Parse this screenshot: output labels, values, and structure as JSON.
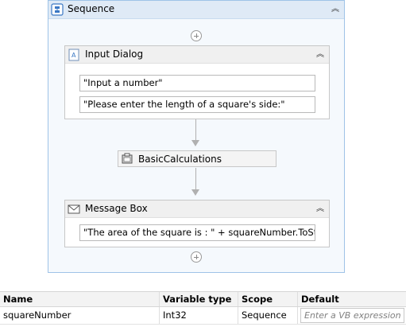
{
  "sequence": {
    "title": "Sequence",
    "icon": "sequence-icon",
    "collapse_glyph": "︽"
  },
  "input_dialog": {
    "title": "Input Dialog",
    "icon": "input-dialog-icon",
    "collapse_glyph": "︽",
    "title_field": "\"Input a number\"",
    "label_field": "\"Please enter the length of a square's side:\""
  },
  "basic_calculations": {
    "title": "BasicCalculations",
    "icon": "workflow-icon"
  },
  "message_box": {
    "title": "Message Box",
    "icon": "envelope-icon",
    "collapse_glyph": "︽",
    "text_field": "\"The area of the square is : \" + squareNumber.ToString"
  },
  "variables": {
    "headers": {
      "name": "Name",
      "type": "Variable type",
      "scope": "Scope",
      "default": "Default"
    },
    "rows": [
      {
        "name": "squareNumber",
        "type": "Int32",
        "scope": "Sequence",
        "default_placeholder": "Enter a VB expression"
      }
    ]
  },
  "colors": {
    "sequence_border": "#9fc3e7",
    "sequence_header": "#dfeaf6",
    "connector": "#b0b0b0"
  }
}
